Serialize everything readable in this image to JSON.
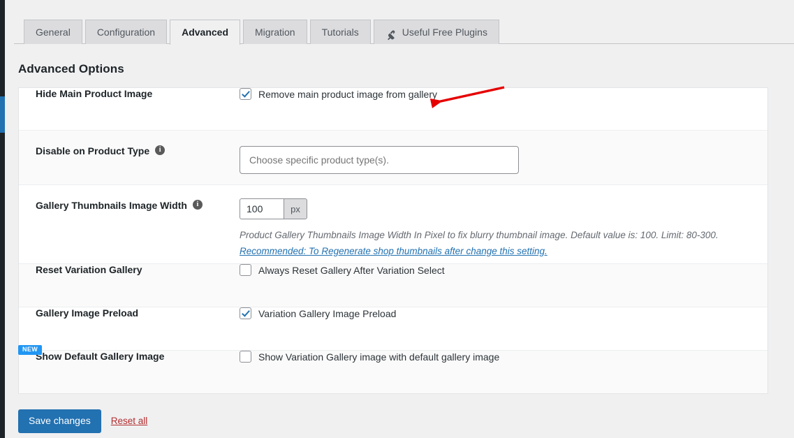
{
  "tabs": [
    {
      "label": "General",
      "active": false,
      "icon": null
    },
    {
      "label": "Configuration",
      "active": false,
      "icon": null
    },
    {
      "label": "Advanced",
      "active": true,
      "icon": null
    },
    {
      "label": "Migration",
      "active": false,
      "icon": null
    },
    {
      "label": "Tutorials",
      "active": false,
      "icon": null
    },
    {
      "label": "Useful Free Plugins",
      "active": false,
      "icon": "plugin-icon"
    }
  ],
  "heading": "Advanced Options",
  "rows": {
    "hide_main_product_image": {
      "label": "Hide Main Product Image",
      "checkbox_label": "Remove main product image from gallery",
      "checked": true
    },
    "disable_on_product_type": {
      "label": "Disable on Product Type",
      "info": "i",
      "placeholder": "Choose specific product type(s).",
      "value": ""
    },
    "gallery_thumbnails_image_width": {
      "label": "Gallery Thumbnails Image Width",
      "info": "i",
      "value": "100",
      "suffix": "px",
      "help": "Product Gallery Thumbnails Image Width In Pixel to fix blurry thumbnail image. Default value is: 100. Limit: 80-300.",
      "help_link": "Recommended: To Regenerate shop thumbnails after change this setting."
    },
    "reset_variation_gallery": {
      "label": "Reset Variation Gallery",
      "checkbox_label": "Always Reset Gallery After Variation Select",
      "checked": false
    },
    "gallery_image_preload": {
      "label": "Gallery Image Preload",
      "checkbox_label": "Variation Gallery Image Preload",
      "checked": true
    },
    "show_default_gallery_image": {
      "label": "Show Default Gallery Image",
      "badge": "NEW",
      "checkbox_label": "Show Variation Gallery image with default gallery image",
      "checked": false
    }
  },
  "footer": {
    "save_label": "Save changes",
    "reset_label": "Reset all"
  },
  "colors": {
    "accent_blue": "#2271b1",
    "badge_blue": "#2196f3",
    "reset_red": "#b32d2e",
    "annotation_red": "#e60000",
    "row_alt_bg": "#fafafa",
    "page_bg": "#f0f0f1"
  },
  "annotation": {
    "type": "arrow",
    "color": "#e60000",
    "points_to": "Remove main product image from gallery"
  }
}
